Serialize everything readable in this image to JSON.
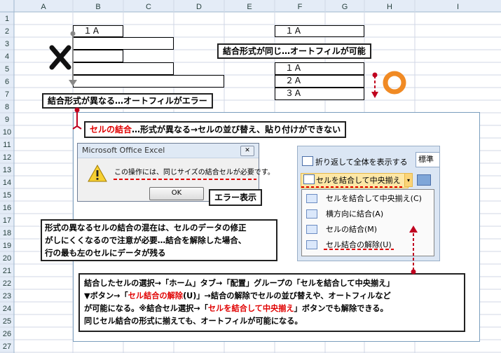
{
  "columns": [
    "A",
    "B",
    "C",
    "D",
    "E",
    "F",
    "G",
    "H",
    "I"
  ],
  "rows": [
    "1",
    "2",
    "3",
    "4",
    "5",
    "6",
    "7",
    "8",
    "9",
    "10",
    "11",
    "12",
    "13",
    "14",
    "15",
    "16",
    "17",
    "18",
    "19",
    "20",
    "21",
    "22",
    "23",
    "24",
    "25",
    "26",
    "27"
  ],
  "cells": {
    "b2": "１Ａ",
    "f2": "１Ａ",
    "f5": "１Ａ",
    "f6": "２Ａ",
    "f7": "３Ａ"
  },
  "labels": {
    "same_format": "結合形式が同じ…オートフィルが可能",
    "diff_format": "結合形式が異なる…オートフィルがエラー",
    "merge_title_red": "セルの結合",
    "merge_title_rest": "…形式が異なる→セルの並び替え、貼り付けができない",
    "error_display": "エラー表示"
  },
  "dialog": {
    "title": "Microsoft Office Excel",
    "close": "✕",
    "message": "この操作には、同じサイズの結合セルが必要です。",
    "ok": "OK"
  },
  "ribbon": {
    "wrap_text": "折り返して全体を表示する",
    "number_format": "標準",
    "merge_center": "セルを結合して中央揃え",
    "menu": [
      "セルを結合して中央揃え(C)",
      "横方向に結合(A)",
      "セルの結合(M)",
      "セル結合の解除(U)"
    ]
  },
  "note1": [
    "形式の異なるセルの結合の混在は、セルのデータの修正",
    "がしにくくなるので注意が必要…結合を解除した場合、",
    "行の最も左のセルにデータが残る"
  ],
  "note2": {
    "l1": "結合したセルの選択→「ホーム」タブ→「配置」グループの「セルを結合して中央揃え」",
    "l2a": "▼ボタン→「",
    "l2b": "セル結合の解除",
    "l2c": "(U)」→結合の解除でセルの並び替えや、オートフィルなど",
    "l3a": "が可能になる。※結合セル選択→「",
    "l3b": "セルを結合して中央揃え",
    "l3c": "」ボタンでも解除できる。",
    "l4": "同じセル結合の形式に揃えても、オートフィルが可能になる。"
  },
  "colors": {
    "accent_red": "#e00000",
    "orange_ring": "#f08a24",
    "arrow_red": "#c0001f"
  }
}
